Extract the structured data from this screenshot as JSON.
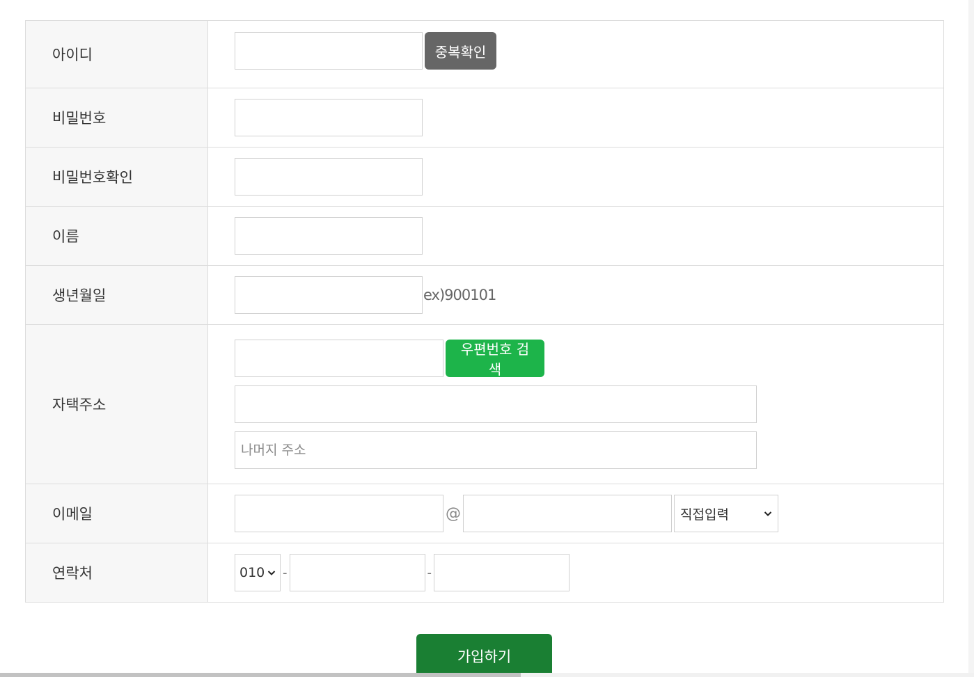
{
  "form": {
    "rows": {
      "id": {
        "label": "아이디",
        "value": "",
        "button": "중복확인"
      },
      "password": {
        "label": "비밀번호",
        "value": ""
      },
      "password_confirm": {
        "label": "비밀번호확인",
        "value": ""
      },
      "name": {
        "label": "이름",
        "value": ""
      },
      "birth": {
        "label": "생년월일",
        "value": "",
        "hint": "ex)900101"
      },
      "address": {
        "label": "자택주소",
        "zip_value": "",
        "zip_button": "우편번호 검색",
        "addr1_value": "",
        "addr2_placeholder": "나머지 주소"
      },
      "email": {
        "label": "이메일",
        "local_value": "",
        "at": "@",
        "domain_value": "",
        "domain_select": "직접입력"
      },
      "phone": {
        "label": "연락처",
        "prefix_select": "010",
        "sep": "-",
        "mid_value": "",
        "last_value": ""
      }
    },
    "submit_label": "가입하기"
  },
  "colors": {
    "label_bg": "#f7f7f7",
    "border": "#dcdcdc",
    "dup_button": "#666666",
    "zip_button": "#1db44a",
    "submit_button": "#1a7f33"
  },
  "icons": {
    "select_arrow": "chevron-down-icon"
  }
}
